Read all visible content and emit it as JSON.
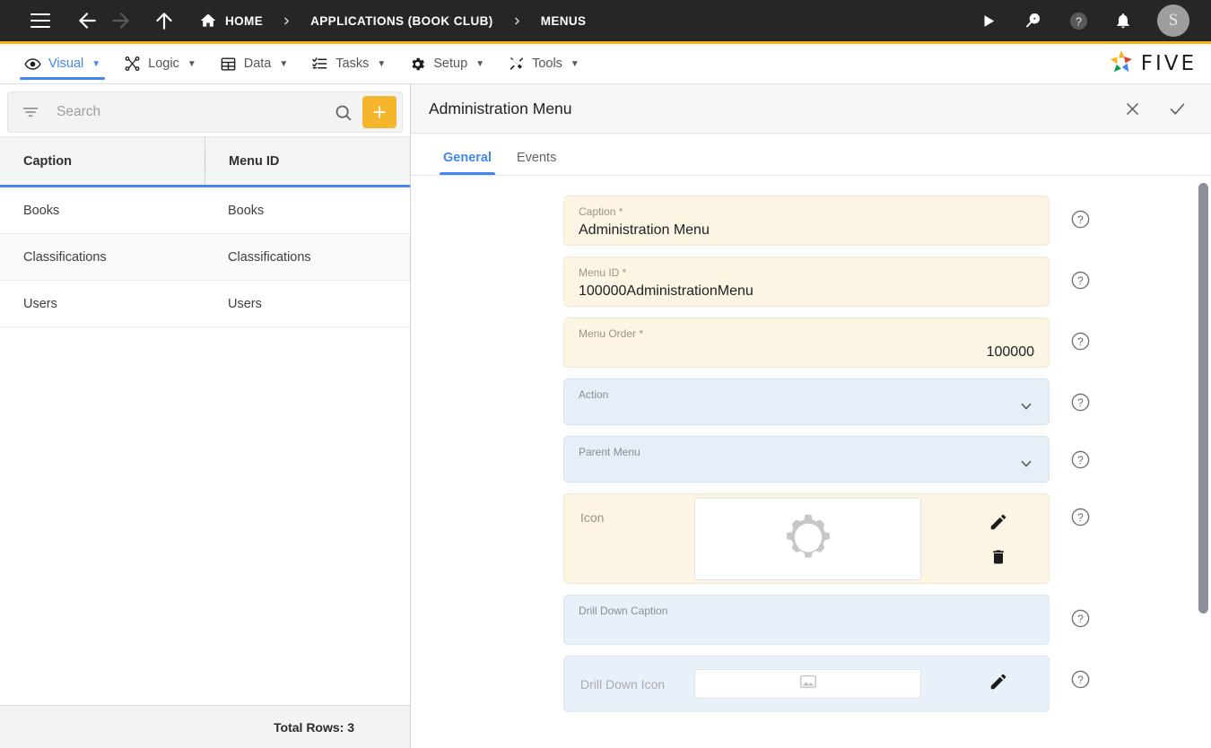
{
  "topbar": {
    "menu_button": "menu",
    "back_label": "back",
    "forward_label": "forward",
    "up_label": "up",
    "breadcrumb": [
      {
        "label": "HOME",
        "icon": "home-icon"
      },
      {
        "label": "APPLICATIONS (BOOK CLUB)",
        "icon": ""
      },
      {
        "label": "MENUS",
        "icon": ""
      }
    ],
    "right_icons": [
      "run-icon",
      "search-play-icon",
      "help-icon",
      "notifications-icon"
    ],
    "avatar_initial": "S",
    "accent_gold": "#f5b316",
    "bg": "#262626"
  },
  "menubar": {
    "items": [
      {
        "label": "Visual",
        "icon": "eye-icon",
        "active": true,
        "caret": "▼"
      },
      {
        "label": "Logic",
        "icon": "logic-nodes-icon",
        "active": false,
        "caret": "▼"
      },
      {
        "label": "Data",
        "icon": "table-grid-icon",
        "active": false,
        "caret": "▼"
      },
      {
        "label": "Tasks",
        "icon": "task-list-icon",
        "active": false,
        "caret": "▼"
      },
      {
        "label": "Setup",
        "icon": "gear-icon",
        "active": false,
        "caret": "▼"
      },
      {
        "label": "Tools",
        "icon": "tools-icon",
        "active": false,
        "caret": "▼"
      }
    ],
    "brand": "FIVE",
    "active_color": "#4285f4"
  },
  "sidebar": {
    "search": {
      "placeholder": "Search",
      "value": "",
      "filter_icon": "filter-icon",
      "search_icon": "search-icon"
    },
    "add_button": "+",
    "add_button_color": "#f5b62e",
    "grid": {
      "columns": [
        "Caption",
        "Menu ID"
      ],
      "rows": [
        {
          "caption": "Books",
          "menu_id": "Books"
        },
        {
          "caption": "Classifications",
          "menu_id": "Classifications"
        },
        {
          "caption": "Users",
          "menu_id": "Users"
        }
      ]
    },
    "footer": {
      "total_rows_label": "Total Rows: 3"
    }
  },
  "detail": {
    "title": "Administration Menu",
    "close_label": "Close",
    "confirm_label": "Confirm",
    "tabs": [
      {
        "label": "General",
        "active": true
      },
      {
        "label": "Events",
        "active": false
      }
    ],
    "fields": [
      {
        "name": "caption",
        "label": "Caption *",
        "value": "Administration Menu",
        "style": "cream",
        "kind": "text",
        "help": "?"
      },
      {
        "name": "menu-id",
        "label": "Menu ID *",
        "value": "100000AdministrationMenu",
        "style": "cream",
        "kind": "text",
        "help": "?"
      },
      {
        "name": "menu-order",
        "label": "Menu Order *",
        "value": "100000",
        "style": "cream",
        "kind": "number",
        "help": "?"
      },
      {
        "name": "action",
        "label": "Action",
        "value": "",
        "style": "blue",
        "kind": "select",
        "help": "?"
      },
      {
        "name": "parent-menu",
        "label": "Parent Menu",
        "value": "",
        "style": "blue",
        "kind": "select",
        "help": "?"
      },
      {
        "name": "icon",
        "label": "Icon",
        "value": "",
        "style": "cream",
        "kind": "image",
        "preview_icon": "manage-accounts-gear-person-icon",
        "edit_label": "edit",
        "delete_label": "delete",
        "help": "?"
      },
      {
        "name": "drill-down-caption",
        "label": "Drill Down Caption",
        "value": "",
        "style": "blue",
        "kind": "text",
        "help": "?"
      },
      {
        "name": "drill-down-icon",
        "label": "Drill Down Icon",
        "value": "",
        "style": "blue",
        "kind": "image-small",
        "preview_icon": "image-placeholder-icon",
        "edit_label": "edit",
        "help": "?"
      }
    ]
  },
  "colors": {
    "cream_field": "#fdf5e3",
    "blue_field": "#e6eef8",
    "accent_blue": "#4285f4",
    "gold": "#f5b316",
    "dark_bar": "#262626"
  }
}
